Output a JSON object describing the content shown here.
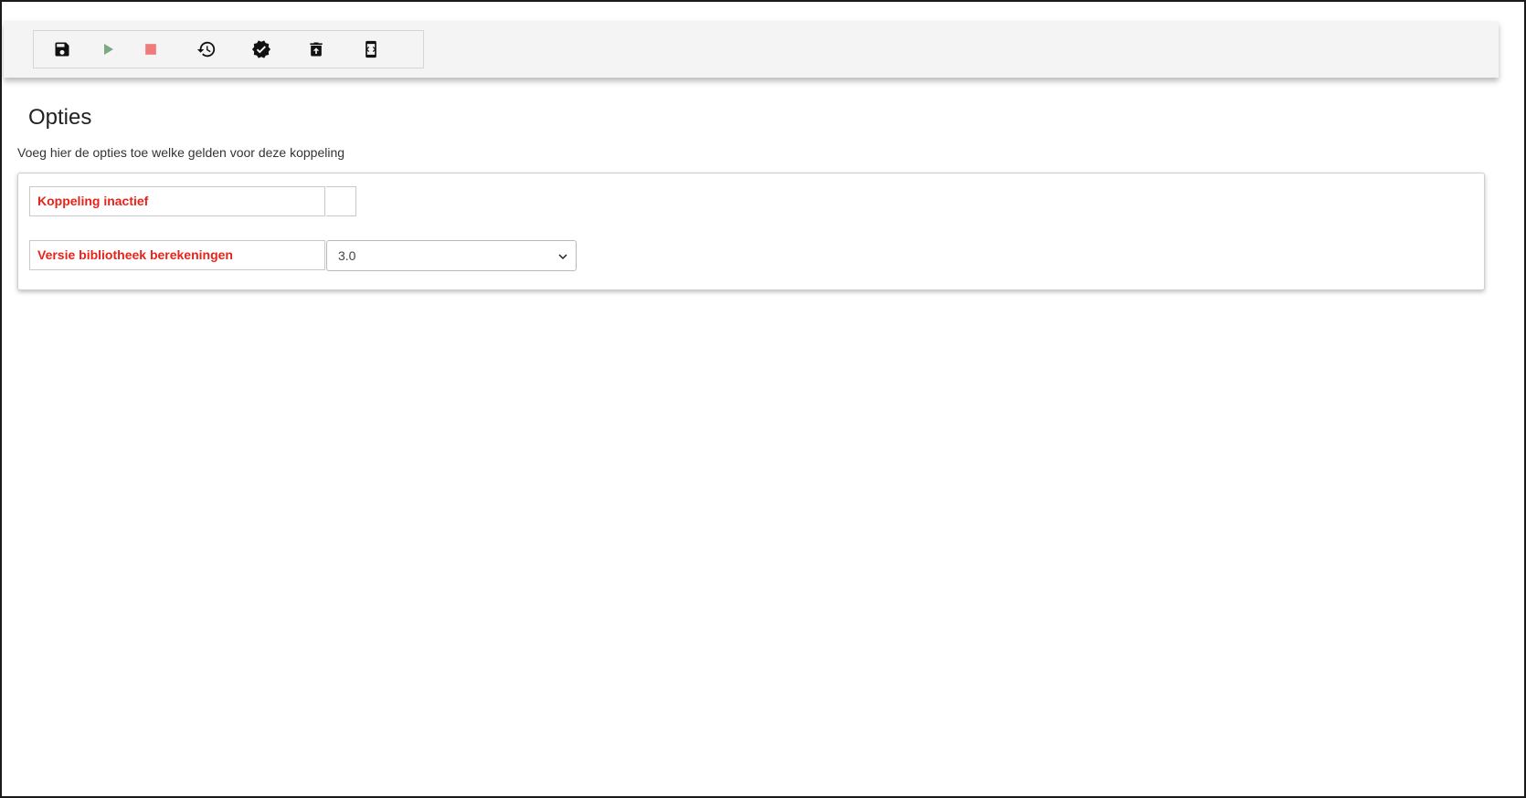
{
  "toolbar": {
    "buttons": [
      {
        "name": "save",
        "icon": "floppy-disk-icon",
        "color": "#111111"
      },
      {
        "name": "start",
        "icon": "play-icon",
        "color": "#7aa982"
      },
      {
        "name": "stop",
        "icon": "stop-icon",
        "color": "#ef7b7b"
      },
      {
        "name": "history",
        "icon": "history-icon",
        "color": "#111111"
      },
      {
        "name": "validate",
        "icon": "verified-badge-icon",
        "color": "#111111"
      },
      {
        "name": "delete",
        "icon": "trash-upload-icon",
        "color": "#111111"
      },
      {
        "name": "code",
        "icon": "phone-code-icon",
        "color": "#111111"
      }
    ]
  },
  "page": {
    "title": "Opties",
    "description": "Voeg hier de opties toe welke gelden voor deze koppeling"
  },
  "options": {
    "inactive_label": "Koppeling inactief",
    "inactive_checked": false,
    "version_label": "Versie bibliotheek berekeningen",
    "version_value": "3.0"
  },
  "colors": {
    "label_red": "#e8231a",
    "toolbar_bg": "#f4f4f4"
  }
}
